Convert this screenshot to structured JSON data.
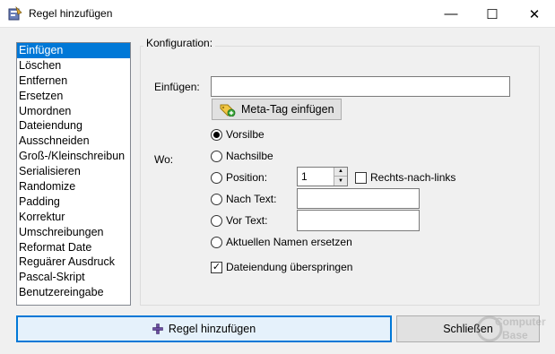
{
  "window": {
    "title": "Regel hinzufügen",
    "minimize_glyph": "—",
    "maximize_glyph": "☐",
    "close_glyph": "✕",
    "app_icon": "rename-tool-icon"
  },
  "rules": {
    "selected": "Einfügen",
    "items": [
      "Einfügen",
      "Löschen",
      "Entfernen",
      "Ersetzen",
      "Umordnen",
      "Dateiendung",
      "Ausschneiden",
      "Groß-/Kleinschreibun",
      "Serialisieren",
      "Randomize",
      "Padding",
      "Korrektur",
      "Umschreibungen",
      "Reformat Date",
      "Reguärer Ausdruck",
      "Pascal-Skript",
      "Benutzereingabe"
    ]
  },
  "config": {
    "group_title": "Konfiguration:",
    "insert_label": "Einfügen:",
    "insert_value": "",
    "meta_button": "Meta-Tag einfügen",
    "meta_icon": "tag-add-icon",
    "where_label": "Wo:",
    "options": {
      "prefix": "Vorsilbe",
      "suffix": "Nachsilbe",
      "position": "Position:",
      "after_text": "Nach Text:",
      "before_text": "Vor Text:",
      "replace_name": "Aktuellen Namen ersetzen"
    },
    "selected_option": "Vorsilbe",
    "position_value": "1",
    "right_to_left_label": "Rechts-nach-links",
    "right_to_left_checked": false,
    "after_text_value": "",
    "before_text_value": "",
    "skip_extension_label": "Dateiendung überspringen",
    "skip_extension_checked": true
  },
  "buttons": {
    "add": "Regel hinzufügen",
    "add_icon": "plus-icon",
    "close": "Schließen"
  },
  "watermark": {
    "line1": "Computer",
    "line2": "Base"
  },
  "colors": {
    "selection": "#0078d7",
    "dialog_bg": "#f0f0f0",
    "default_button_bg": "#e5f1fb"
  }
}
